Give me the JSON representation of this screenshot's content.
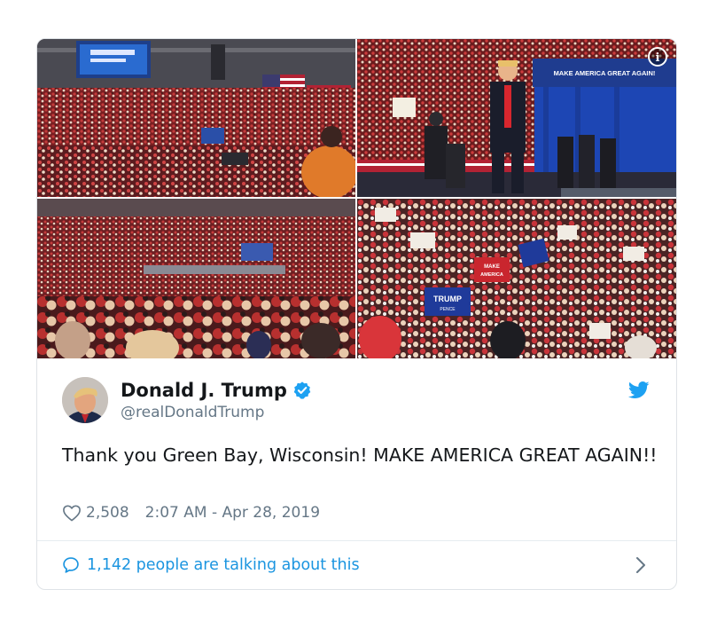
{
  "tweet": {
    "display_name": "Donald J. Trump",
    "handle": "@realDonaldTrump",
    "text": "Thank you Green Bay, Wisconsin! MAKE AMERICA GREAT AGAIN!!",
    "likes": "2,508",
    "timestamp": "2:07 AM - Apr 28, 2019",
    "talking": "1,142 people are talking about this"
  },
  "media": {
    "banner_text": "MAKE AMERICA GREAT AGAIN!",
    "sign_trump": "TRUMP",
    "sign_pence": "PENCE",
    "sign_make": "MAKE",
    "sign_america": "AMERICA"
  },
  "icons": {
    "info": "info-icon",
    "verified": "verified-badge-icon",
    "bird": "twitter-bird-icon",
    "heart": "heart-icon",
    "bubble": "speech-bubble-icon",
    "chevron": "chevron-right-icon"
  },
  "colors": {
    "link": "#1b95e0",
    "muted": "#657786",
    "text": "#14171a",
    "verified": "#1da1f2",
    "border": "#dfe3e7"
  }
}
